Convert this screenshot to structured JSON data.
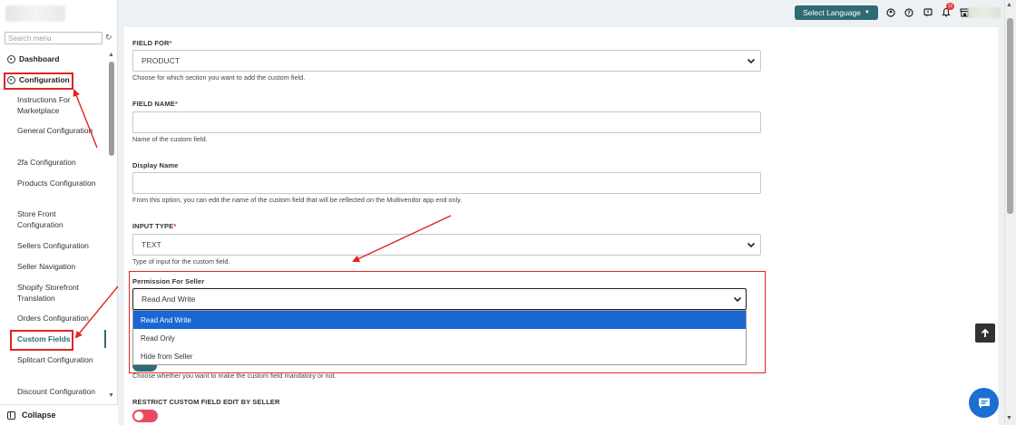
{
  "sidebar": {
    "search_placeholder": "Search menu",
    "dashboard": "Dashboard",
    "configuration": "Configuration",
    "items": [
      {
        "label": "Instructions For Marketplace"
      },
      {
        "label": "General Configuration"
      },
      {
        "label": "2fa Configuration"
      },
      {
        "label": "Products Configuration"
      },
      {
        "label": "Store Front Configuration"
      },
      {
        "label": "Sellers Configuration"
      },
      {
        "label": "Seller Navigation"
      },
      {
        "label": "Shopify Storefront Translation"
      },
      {
        "label": "Orders Configuration"
      },
      {
        "label": "Custom Fields"
      },
      {
        "label": "Splitcart Configuration"
      },
      {
        "label": "Discount Configuration"
      }
    ],
    "collapse": "Collapse"
  },
  "header": {
    "language_button": "Select Language",
    "notification_count": "12"
  },
  "form": {
    "field_for": {
      "label": "FIELD FOR",
      "required": "*",
      "value": "PRODUCT",
      "help": "Choose for which section you want to add the custom field."
    },
    "field_name": {
      "label": "FIELD NAME",
      "required": "*",
      "value": "",
      "help": "Name of the custom field."
    },
    "display_name": {
      "label": "Display Name",
      "value": "",
      "help": "From this option, you can edit the name of the custom field that will be reflected on the Multivendor app end only."
    },
    "input_type": {
      "label": "INPUT TYPE",
      "required": "*",
      "value": "TEXT",
      "help": "Type of input for the custom field."
    },
    "permission": {
      "label": "Permission For Seller",
      "value": "Read And Write",
      "options": [
        "Read And Write",
        "Read Only",
        "Hide from Seller"
      ]
    },
    "mandatory_help": "Choose whether you want to make the custom field mandatory or not.",
    "restrict_label": "RESTRICT CUSTOM FIELD EDIT BY SELLER"
  },
  "colors": {
    "accent": "#2f6b73",
    "annotation": "#e02424",
    "selected_option": "#1967d2",
    "toggle_off": "#e84b5f",
    "chat": "#1a6fd0"
  }
}
